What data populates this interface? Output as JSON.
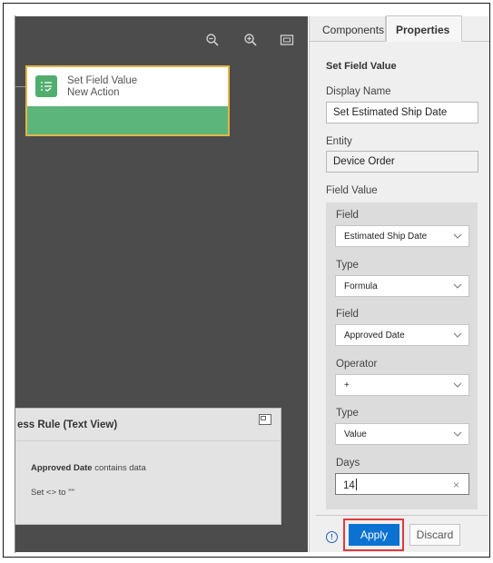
{
  "canvas": {
    "toolbar": {
      "zoom_out_icon": "zoom-out-icon",
      "zoom_in_icon": "zoom-in-icon",
      "fit_icon": "fit-to-screen-icon"
    },
    "node": {
      "title": "Set Field Value",
      "subtitle": "New Action",
      "icon": "list-check-icon",
      "colors": {
        "border": "#e2b546",
        "bar": "#5cb57b"
      }
    },
    "rule_panel": {
      "title": "ess Rule (Text View)",
      "line1_bold": "Approved Date",
      "line1_rest": " contains data",
      "line2": "Set <> to \"\""
    }
  },
  "sidebar": {
    "tabs": [
      {
        "label": "Components"
      },
      {
        "label": "Properties"
      }
    ],
    "section_title": "Set Field Value",
    "display_name": {
      "label": "Display Name",
      "value": "Set Estimated Ship Date"
    },
    "entity": {
      "label": "Entity",
      "value": "Device Order"
    },
    "field_value": {
      "label": "Field Value",
      "field1": {
        "label": "Field",
        "value": "Estimated Ship Date"
      },
      "type1": {
        "label": "Type",
        "value": "Formula"
      },
      "field2": {
        "label": "Field",
        "value": "Approved Date"
      },
      "operator": {
        "label": "Operator",
        "value": "+"
      },
      "type2": {
        "label": "Type",
        "value": "Value"
      },
      "days": {
        "label": "Days",
        "value": "14",
        "clear": "×"
      }
    },
    "footer": {
      "info_icon": "info-icon",
      "info_glyph": "!",
      "apply": "Apply",
      "discard": "Discard"
    }
  },
  "colors": {
    "canvas_bg": "#4c4c4c",
    "apply_bg": "#0b72d1",
    "highlight": "#e0393e"
  }
}
